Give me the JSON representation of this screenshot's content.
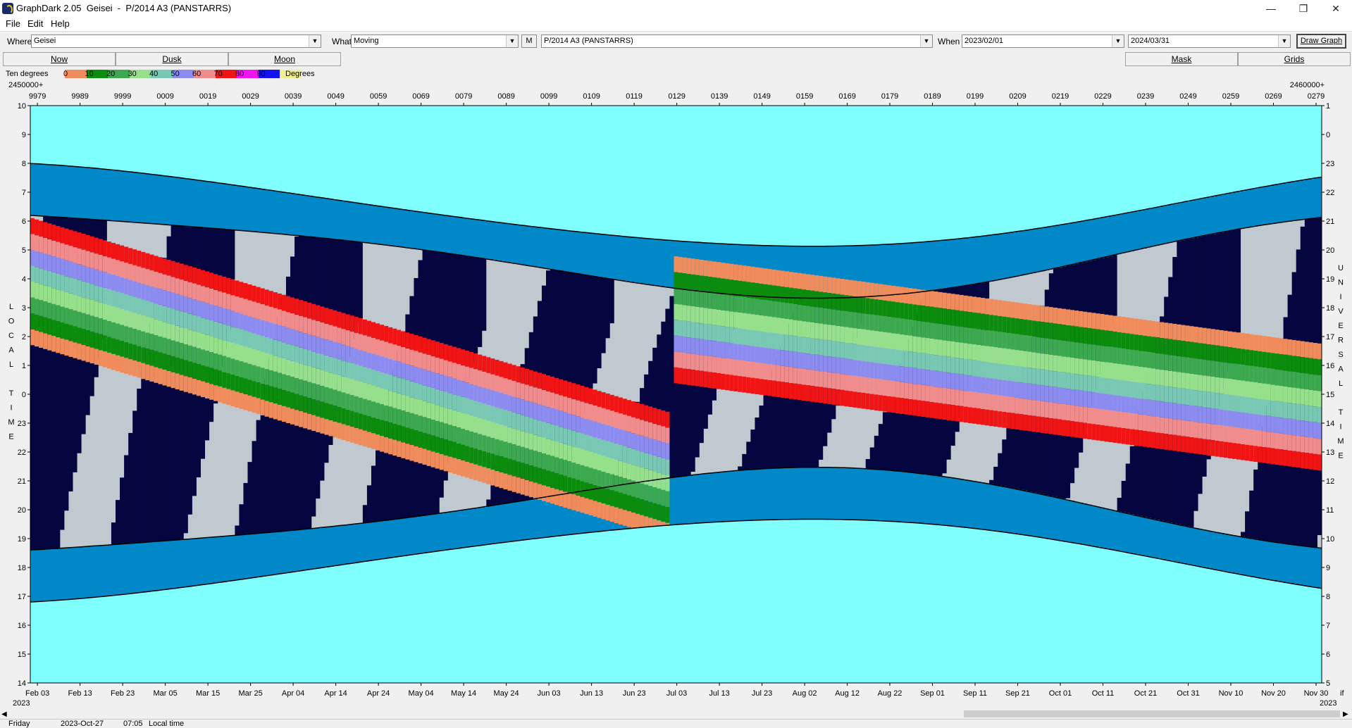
{
  "window": {
    "title": "GraphDark 2.05  Geisei  -  P/2014 A3 (PANSTARRS)"
  },
  "menu": [
    "File",
    "Edit",
    "Help"
  ],
  "toolbar": {
    "where_label": "Where",
    "where_value": "Geisei",
    "what_label": "What",
    "what_value": "Moving",
    "m_button": "M",
    "object_value": "P/2014 A3 (PANSTARRS)",
    "when_label": "When",
    "start_date": "2023/02/01",
    "end_date": "2024/03/31",
    "draw_button": "Draw Graph"
  },
  "toolbar2": {
    "now": "Now",
    "dusk": "Dusk",
    "moon": "Moon",
    "mask": "Mask",
    "grids": "Grids"
  },
  "legend": {
    "title": "Ten degrees",
    "unit": "Degrees",
    "entries": [
      {
        "label": "0",
        "color": "#f08c5c"
      },
      {
        "label": "10",
        "color": "#0c8c0c"
      },
      {
        "label": "20",
        "color": "#3ca850"
      },
      {
        "label": "30",
        "color": "#96e08c"
      },
      {
        "label": "40",
        "color": "#78c8b4"
      },
      {
        "label": "50",
        "color": "#8c8cf0"
      },
      {
        "label": "60",
        "color": "#f08c8c"
      },
      {
        "label": "70",
        "color": "#f01414"
      },
      {
        "label": "80",
        "color": "#f014f0"
      },
      {
        "label": "90",
        "color": "#1414f0"
      },
      {
        "label": "",
        "color": "#f0f08c"
      }
    ]
  },
  "chart_data": {
    "type": "heatmap",
    "jd_left_label": "2450000+",
    "jd_right_label": "2460000+",
    "jd_ticks": [
      "9979",
      "9989",
      "9999",
      "0009",
      "0019",
      "0029",
      "0039",
      "0049",
      "0059",
      "0069",
      "0079",
      "0089",
      "0099",
      "0109",
      "0119",
      "0129",
      "0139",
      "0149",
      "0159",
      "0169",
      "0179",
      "0189",
      "0199",
      "0209",
      "0219",
      "0229",
      "0239",
      "0249",
      "0259",
      "0269",
      "0279"
    ],
    "date_ticks": [
      "Feb 03",
      "Feb 13",
      "Feb 23",
      "Mar 05",
      "Mar 15",
      "Mar 25",
      "Apr 04",
      "Apr 14",
      "Apr 24",
      "May 04",
      "May 14",
      "May 24",
      "Jun 03",
      "Jun 13",
      "Jun 23",
      "Jul 03",
      "Jul 13",
      "Jul 23",
      "Aug 02",
      "Aug 12",
      "Aug 22",
      "Sep 01",
      "Sep 11",
      "Sep 21",
      "Oct 01",
      "Oct 11",
      "Oct 21",
      "Oct 31",
      "Nov 10",
      "Nov 20",
      "Nov 30"
    ],
    "year_left": "2023",
    "year_right": "2023",
    "corner_label": "if",
    "left_axis_ticks": [
      "10",
      "9",
      "8",
      "7",
      "6",
      "5",
      "4",
      "3",
      "2",
      "1",
      "0",
      "23",
      "22",
      "21",
      "20",
      "19",
      "18",
      "17",
      "16",
      "15",
      "14"
    ],
    "right_axis_ticks": [
      "1",
      "0",
      "23",
      "22",
      "21",
      "20",
      "19",
      "18",
      "17",
      "16",
      "15",
      "14",
      "13",
      "12",
      "11",
      "10",
      "9",
      "8",
      "7",
      "6",
      "5"
    ],
    "left_axis_title": [
      "L",
      "O",
      "C",
      "A",
      "L",
      "",
      "T",
      "I",
      "M",
      "E"
    ],
    "right_axis_title": [
      "U",
      "N",
      "I",
      "V",
      "E",
      "R",
      "S",
      "A",
      "L",
      "",
      "T",
      "I",
      "M",
      "E"
    ],
    "colors": {
      "daylight": "#80ffff",
      "twilight": "#0088c8",
      "dark_night": "#050540",
      "moonlit": "#c0c8d0",
      "curve": "#000000"
    }
  },
  "status": {
    "day": "Friday",
    "date": "2023-Oct-27",
    "time": "07:05",
    "mode": "Local time"
  }
}
